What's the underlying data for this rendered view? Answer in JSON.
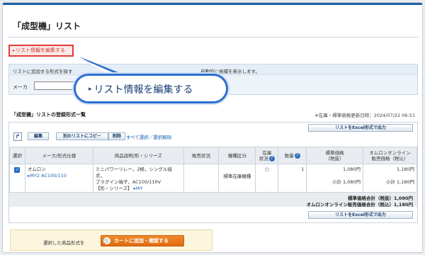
{
  "page": {
    "title": "「成型機」リスト"
  },
  "edit_button": {
    "label": "リスト情報を編集する",
    "arrow": "▸"
  },
  "search": {
    "header_left": "リストに追加する形式を探す",
    "header_right": "自動的に候補を表示します。",
    "maker_label": "メーカ",
    "maker_value": ""
  },
  "callout": {
    "arrow": "▸",
    "text": "リスト情報を編集する"
  },
  "list": {
    "title": "「成型機」リストの登録形式一覧",
    "updated": "※在庫・標準価格更新日時：2024/07/22 06:51"
  },
  "toolbar": {
    "delete_label": "編集",
    "copy_label": "別のリストにコピー",
    "remove_label": "削除",
    "select_all_link": "すべて選択／選択解除",
    "excel_label": "リストをExcel形式で出力"
  },
  "table": {
    "headers": {
      "select": "選択",
      "maker": "メーカ/形式仕様",
      "desc": "商品説明/形・シリーズ",
      "status": "販売状況",
      "type": "機種区分",
      "stock_l1": "在庫",
      "stock_l2": "状況",
      "qty": "数量",
      "std_l1": "標準価格",
      "std_l2": "（税抜）",
      "online_l1": "オムロンオンライン",
      "online_l2": "販売価格（税込）"
    },
    "rows": [
      {
        "checked": "✓",
        "maker": "オムロン",
        "model": "MY2 AC100/110",
        "desc_l1": "ミニパワーリレー，2極，シングル接点，",
        "desc_l2": "プラグイン端子，AC100/110V",
        "desc_l3": "【形・シリーズ】",
        "series_link": "MY",
        "status": "",
        "type": "標準在庫機種",
        "stock": "○",
        "qty": "1",
        "std_price": "1,080円",
        "std_subtotal": "小計 1,080円",
        "online_price": "1,180円",
        "online_subtotal": "小計 1,180円"
      }
    ]
  },
  "totals": {
    "std": "標準価格合計（税抜）1,080円",
    "online": "オムロンオンライン販売価格合計（税込）1,180円"
  },
  "cart": {
    "label": "選択した商品形式を",
    "button": "カートに追加・確認する"
  },
  "colors": {
    "accent": "#1f5fa8",
    "highlight": "#e23a36",
    "cart": "#e06a10"
  }
}
